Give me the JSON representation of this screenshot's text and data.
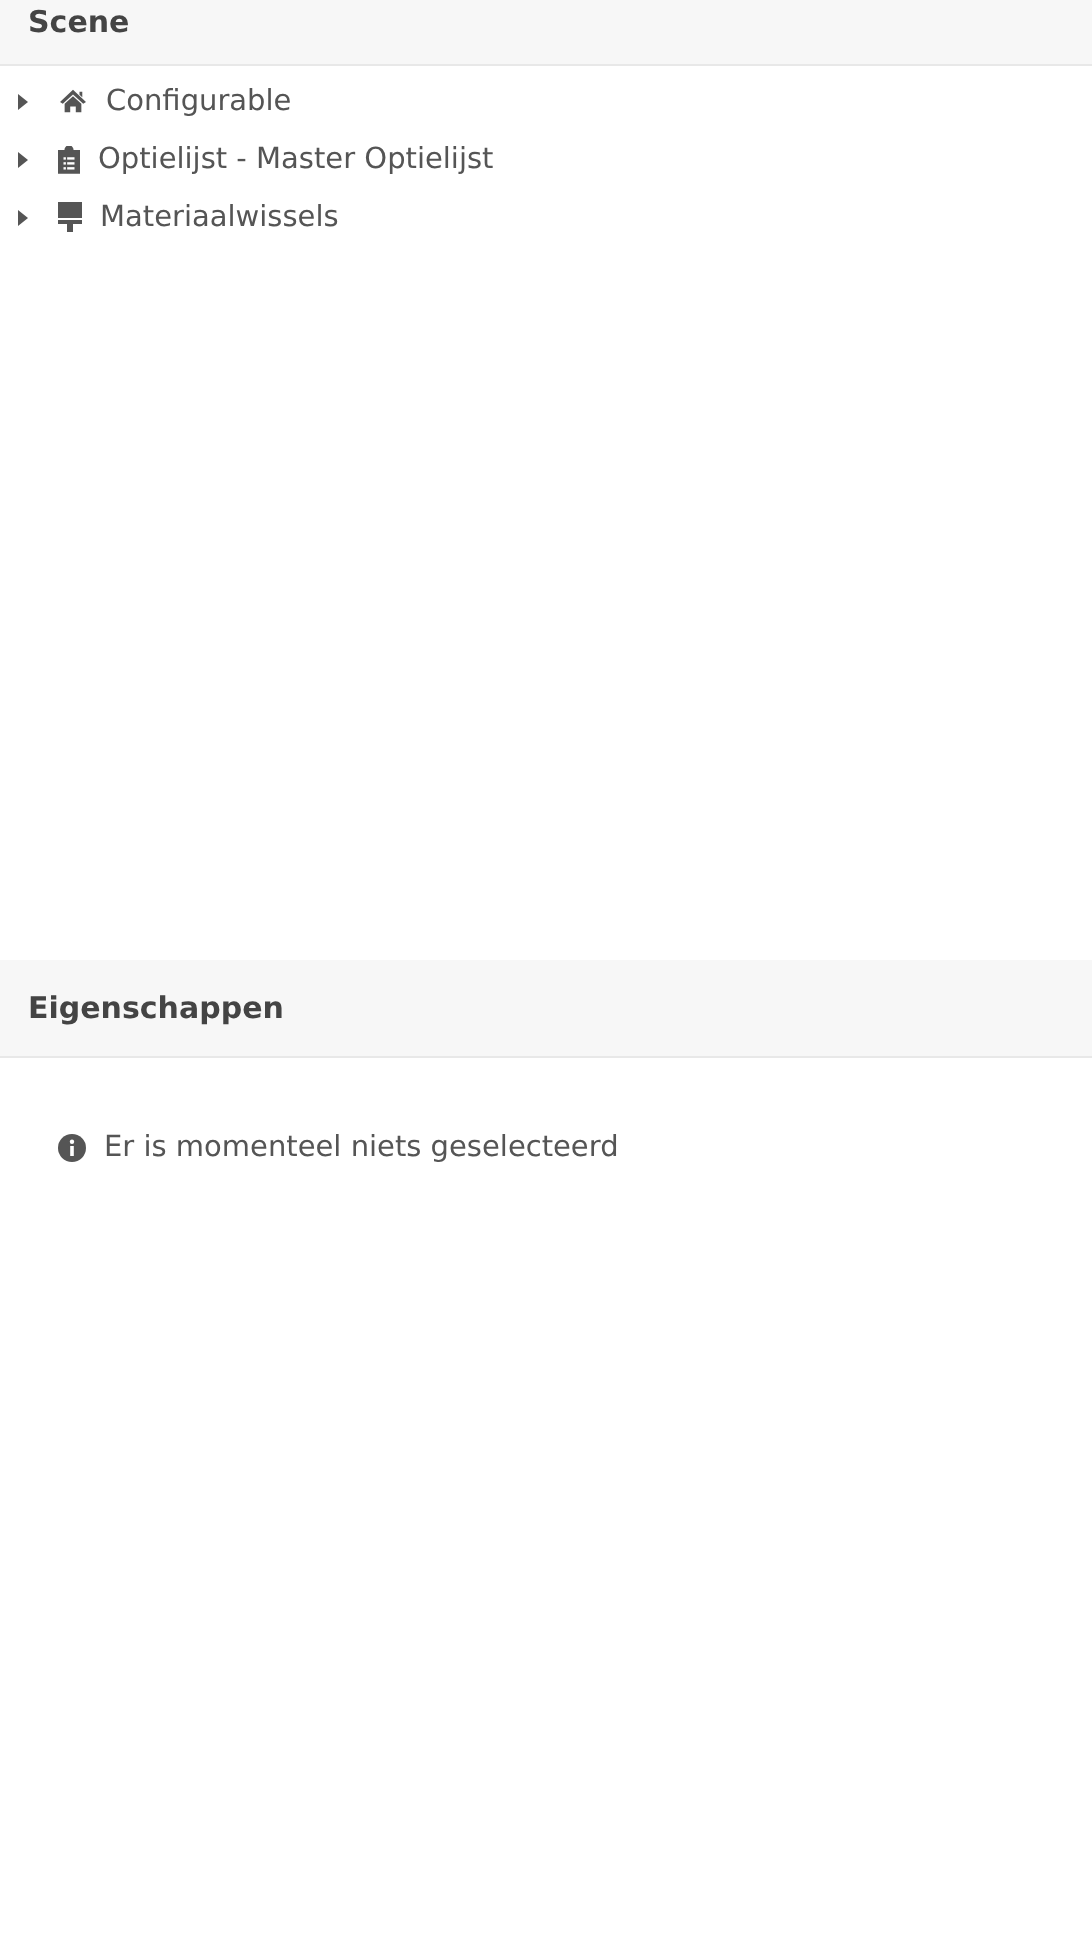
{
  "scene": {
    "title": "Scene",
    "items": [
      {
        "label": "Configurable",
        "kind": "home",
        "expanded": false
      },
      {
        "label": "Optielijst - Master Optielijst",
        "kind": "clipboard",
        "expanded": false
      },
      {
        "label": "Materiaalwissels",
        "kind": "brush",
        "expanded": false
      }
    ]
  },
  "properties": {
    "title": "Eigenschappen",
    "message": "Er is momenteel niets geselecteerd"
  }
}
